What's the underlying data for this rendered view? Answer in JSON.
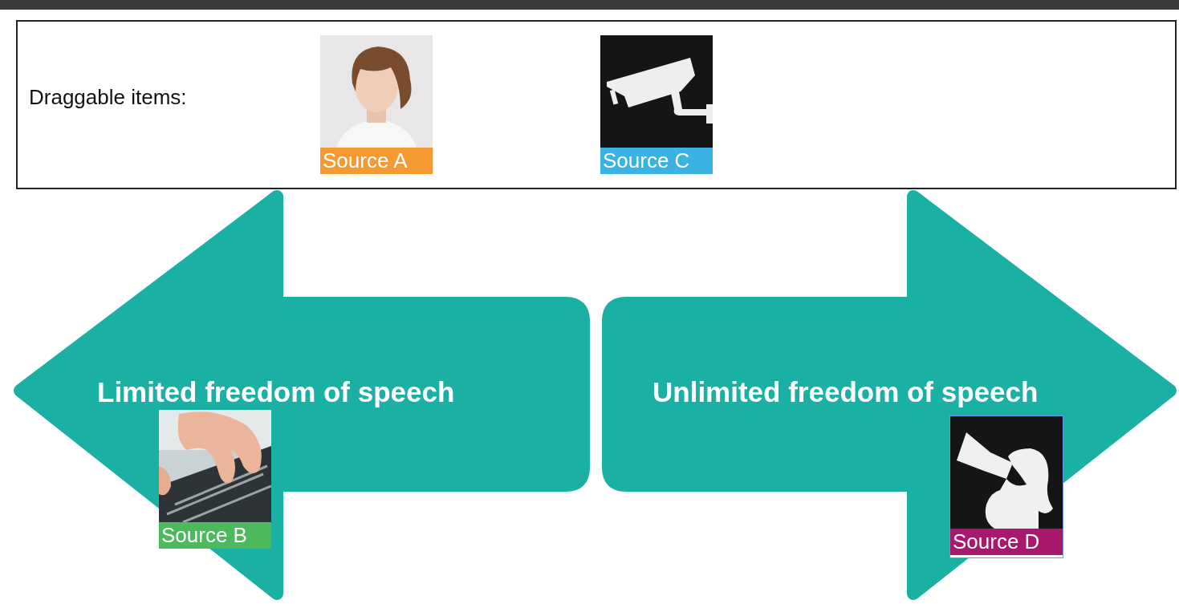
{
  "tray": {
    "label": "Draggable items:",
    "items": [
      {
        "label": "Source A",
        "color": "#f59a32",
        "kind": "portrait",
        "selected": false
      },
      {
        "label": "Source C",
        "color": "#3cb1e3",
        "kind": "camera",
        "selected": false
      }
    ]
  },
  "zones": [
    {
      "label": "Limited freedom of speech",
      "items": [
        {
          "label": "Source B",
          "color": "#4cba5c",
          "kind": "typing",
          "selected": false
        }
      ]
    },
    {
      "label": "Unlimited freedom of speech",
      "items": [
        {
          "label": "Source D",
          "color": "#a8186c",
          "kind": "megaphone",
          "selected": true
        }
      ]
    }
  ]
}
